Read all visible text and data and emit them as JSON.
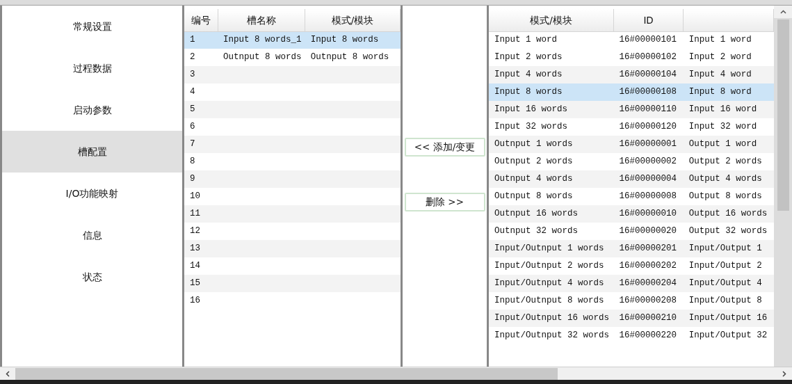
{
  "sidebar": {
    "items": [
      {
        "label": "常规设置",
        "selected": false
      },
      {
        "label": "过程数据",
        "selected": false
      },
      {
        "label": "启动参数",
        "selected": false
      },
      {
        "label": "槽配置",
        "selected": true
      },
      {
        "label": "I/O功能映射",
        "selected": false
      },
      {
        "label": "信息",
        "selected": false
      },
      {
        "label": "状态",
        "selected": false
      }
    ]
  },
  "slot_table": {
    "columns": [
      "编号",
      "槽名称",
      "模式/模块"
    ],
    "rows": [
      {
        "cells": [
          "1",
          "Input 8 words_1",
          "Input 8 words"
        ],
        "selected": true
      },
      {
        "cells": [
          "2",
          "Outnput 8 words",
          "Outnput 8 words"
        ],
        "selected": false
      },
      {
        "cells": [
          "3"
        ],
        "selected": false
      },
      {
        "cells": [
          "4"
        ],
        "selected": false
      },
      {
        "cells": [
          "5"
        ],
        "selected": false
      },
      {
        "cells": [
          "6"
        ],
        "selected": false
      },
      {
        "cells": [
          "7"
        ],
        "selected": false
      },
      {
        "cells": [
          "8"
        ],
        "selected": false
      },
      {
        "cells": [
          "9"
        ],
        "selected": false
      },
      {
        "cells": [
          "10"
        ],
        "selected": false
      },
      {
        "cells": [
          "11"
        ],
        "selected": false
      },
      {
        "cells": [
          "12"
        ],
        "selected": false
      },
      {
        "cells": [
          "13"
        ],
        "selected": false
      },
      {
        "cells": [
          "14"
        ],
        "selected": false
      },
      {
        "cells": [
          "15"
        ],
        "selected": false
      },
      {
        "cells": [
          "16"
        ],
        "selected": false
      }
    ]
  },
  "buttons": [
    "<< 添加/变更",
    "删除 >>"
  ],
  "module_table": {
    "columns": [
      "模式/模块",
      "ID"
    ],
    "rows": [
      {
        "cells": [
          "Input 1 word",
          "16#00000101",
          "Input 1 word"
        ],
        "selected": false
      },
      {
        "cells": [
          "Input 2 words",
          "16#00000102",
          "Input 2 word"
        ],
        "selected": false
      },
      {
        "cells": [
          "Input 4 words",
          "16#00000104",
          "Input 4 word"
        ],
        "selected": false
      },
      {
        "cells": [
          "Input 8 words",
          "16#00000108",
          "Input 8 word"
        ],
        "selected": true
      },
      {
        "cells": [
          "Input 16 words",
          "16#00000110",
          "Input 16 word"
        ],
        "selected": false
      },
      {
        "cells": [
          "Input 32 words",
          "16#00000120",
          "Input 32 word"
        ],
        "selected": false
      },
      {
        "cells": [
          "Outnput 1 words",
          "16#00000001",
          "Output 1 word"
        ],
        "selected": false
      },
      {
        "cells": [
          "Outnput 2 words",
          "16#00000002",
          "Output 2 words"
        ],
        "selected": false
      },
      {
        "cells": [
          "Outnput 4 words",
          "16#00000004",
          "Output 4 words"
        ],
        "selected": false
      },
      {
        "cells": [
          "Outnput 8 words",
          "16#00000008",
          "Output 8 words"
        ],
        "selected": false
      },
      {
        "cells": [
          "Outnput 16 words",
          "16#00000010",
          "Output 16 words"
        ],
        "selected": false
      },
      {
        "cells": [
          "Outnput 32 words",
          "16#00000020",
          "Output 32 words"
        ],
        "selected": false
      },
      {
        "cells": [
          "Input/Outnput 1 words",
          "16#00000201",
          "Input/Output 1"
        ],
        "selected": false
      },
      {
        "cells": [
          "Input/Outnput 2 words",
          "16#00000202",
          "Input/Output 2"
        ],
        "selected": false
      },
      {
        "cells": [
          "Input/Outnput 4 words",
          "16#00000204",
          "Input/Output 4"
        ],
        "selected": false
      },
      {
        "cells": [
          "Input/Outnput 8 words",
          "16#00000208",
          "Input/Output 8"
        ],
        "selected": false
      },
      {
        "cells": [
          "Input/Outnput 16 words",
          "16#00000210",
          "Input/Output 16"
        ],
        "selected": false
      },
      {
        "cells": [
          "Input/Outnput 32 words",
          "16#00000220",
          "Input/Output 32"
        ],
        "selected": false
      }
    ]
  }
}
